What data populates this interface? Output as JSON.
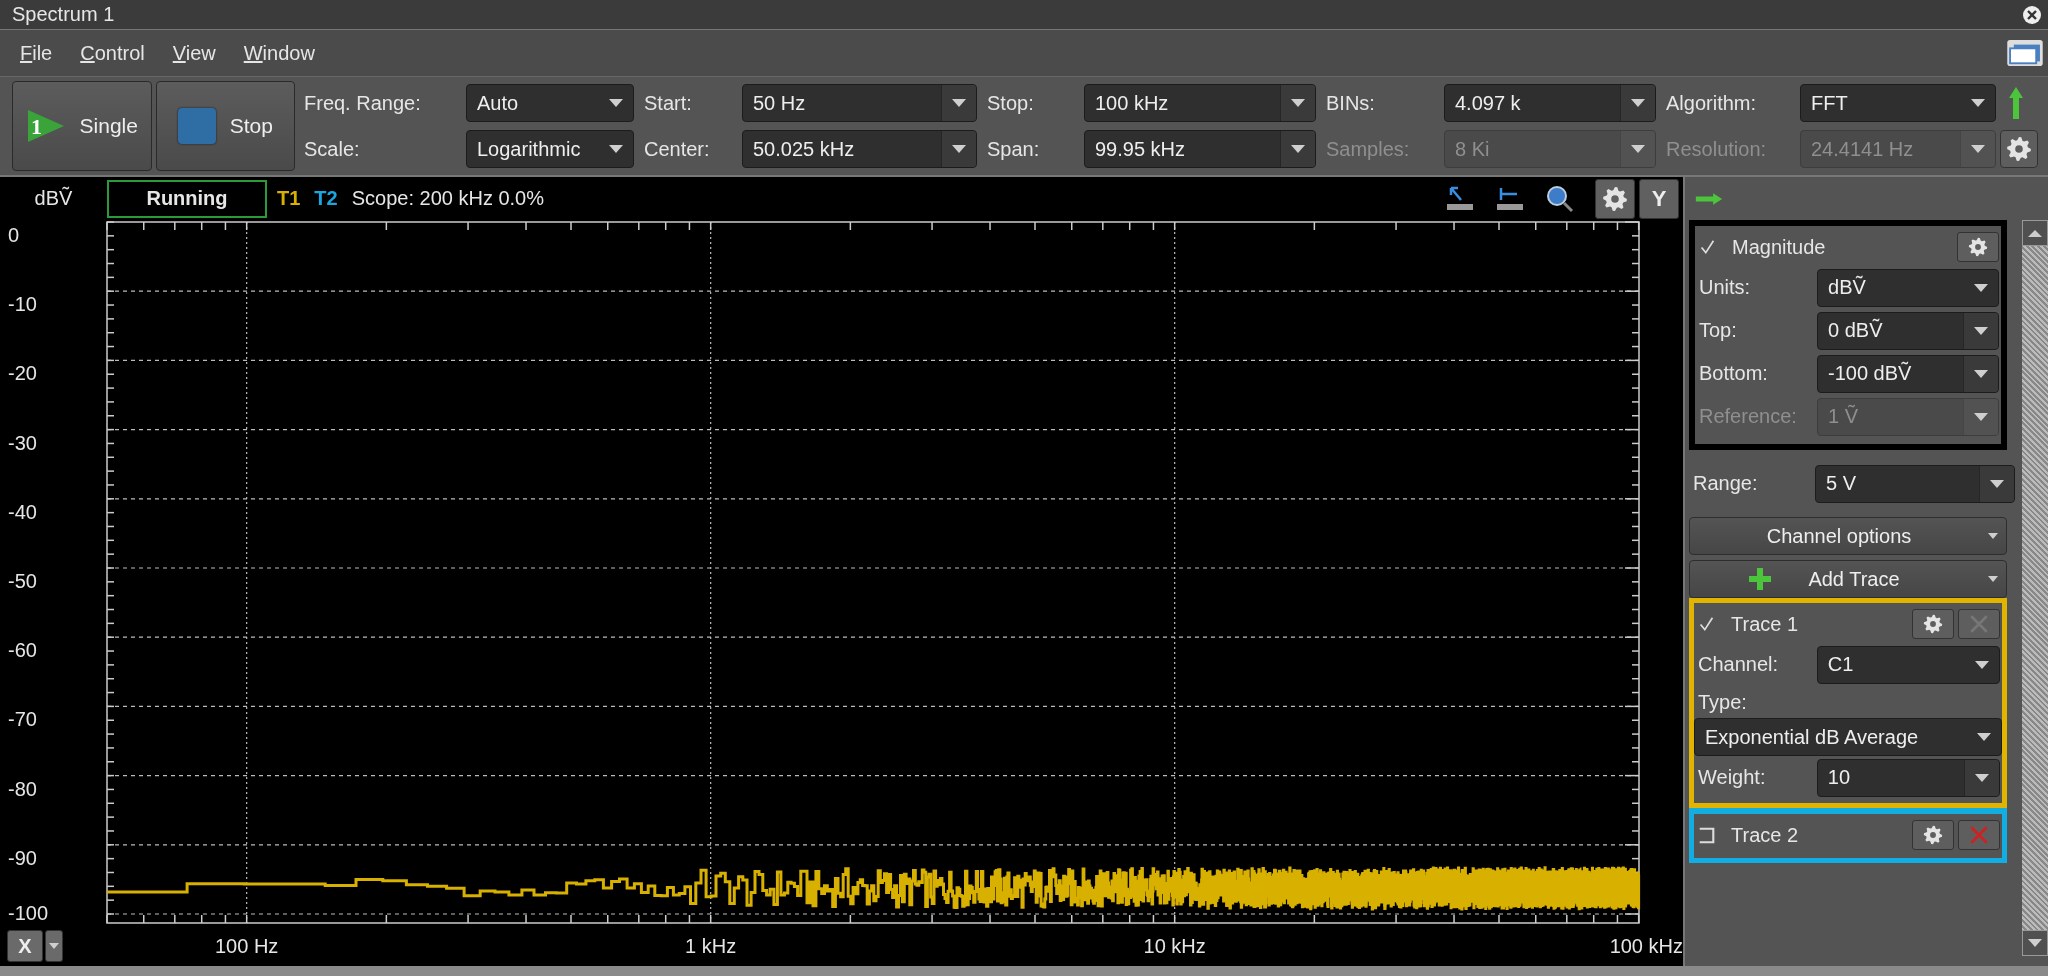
{
  "window": {
    "title": "Spectrum 1"
  },
  "menu": [
    "File",
    "Control",
    "View",
    "Window"
  ],
  "toolbar": {
    "buttons": [
      {
        "label": "Single",
        "kind": "single",
        "icon_text": "1"
      },
      {
        "label": "Stop",
        "kind": "stop"
      }
    ],
    "fields": [
      {
        "label": "Freq. Range:",
        "value": "Auto",
        "editable": false,
        "disabled": false
      },
      {
        "label": "Scale:",
        "value": "Logarithmic",
        "editable": false,
        "disabled": false
      },
      {
        "label": "Start:",
        "value": "50 Hz",
        "editable": true,
        "disabled": false
      },
      {
        "label": "Center:",
        "value": "50.025 kHz",
        "editable": true,
        "disabled": false
      },
      {
        "label": "Stop:",
        "value": "100 kHz",
        "editable": true,
        "disabled": false
      },
      {
        "label": "Span:",
        "value": "99.95 kHz",
        "editable": true,
        "disabled": false
      },
      {
        "label": "BINs:",
        "value": "4.097 k",
        "editable": true,
        "disabled": false
      },
      {
        "label": "Samples:",
        "value": "8 Ki",
        "editable": true,
        "disabled": true
      },
      {
        "label": "Algorithm:",
        "value": "FFT",
        "editable": false,
        "disabled": false
      },
      {
        "label": "Resolution:",
        "value": "24.4141 Hz",
        "editable": true,
        "disabled": true
      }
    ]
  },
  "plot": {
    "unit": "dBṼ",
    "status": "Running",
    "legend": [
      {
        "label": "T1",
        "color": "#d8b000"
      },
      {
        "label": "T2",
        "color": "#1aa6e0"
      }
    ],
    "scope": "Scope: 200 kHz 0.0%",
    "y_button": "Y",
    "x_button": "X",
    "y_ticks": [
      "0",
      "-10",
      "-20",
      "-30",
      "-40",
      "-50",
      "-60",
      "-70",
      "-80",
      "-90",
      "-100"
    ],
    "x_ticks": [
      "100 Hz",
      "1 kHz",
      "10 kHz",
      "100 kHz"
    ]
  },
  "panel": {
    "magnitude": {
      "title": "Magnitude",
      "checked": true,
      "fields": [
        {
          "label": "Units:",
          "value": "dBṼ",
          "editable": false,
          "disabled": false
        },
        {
          "label": "Top:",
          "value": "0 dBṼ",
          "editable": true,
          "disabled": false
        },
        {
          "label": "Bottom:",
          "value": "-100 dBṼ",
          "editable": true,
          "disabled": false
        },
        {
          "label": "Reference:",
          "value": "1 Ṽ",
          "editable": true,
          "disabled": true
        }
      ]
    },
    "range": {
      "label": "Range:",
      "value": "5 V",
      "editable": true,
      "disabled": false
    },
    "channel_options": "Channel options",
    "add_trace": "Add Trace",
    "traces": [
      {
        "name": "Trace 1",
        "checked": true,
        "color": "#e0b400",
        "delete_disabled": true,
        "fields": [
          {
            "label": "Channel:",
            "value": "C1",
            "editable": false,
            "kind": "inline"
          },
          {
            "label": "Type:",
            "value": "Exponential dB Average",
            "editable": false,
            "kind": "stacked"
          },
          {
            "label": "Weight:",
            "value": "10",
            "editable": true,
            "kind": "inline"
          }
        ]
      },
      {
        "name": "Trace 2",
        "checked": false,
        "color": "#12aee2",
        "delete_disabled": false
      }
    ]
  }
}
